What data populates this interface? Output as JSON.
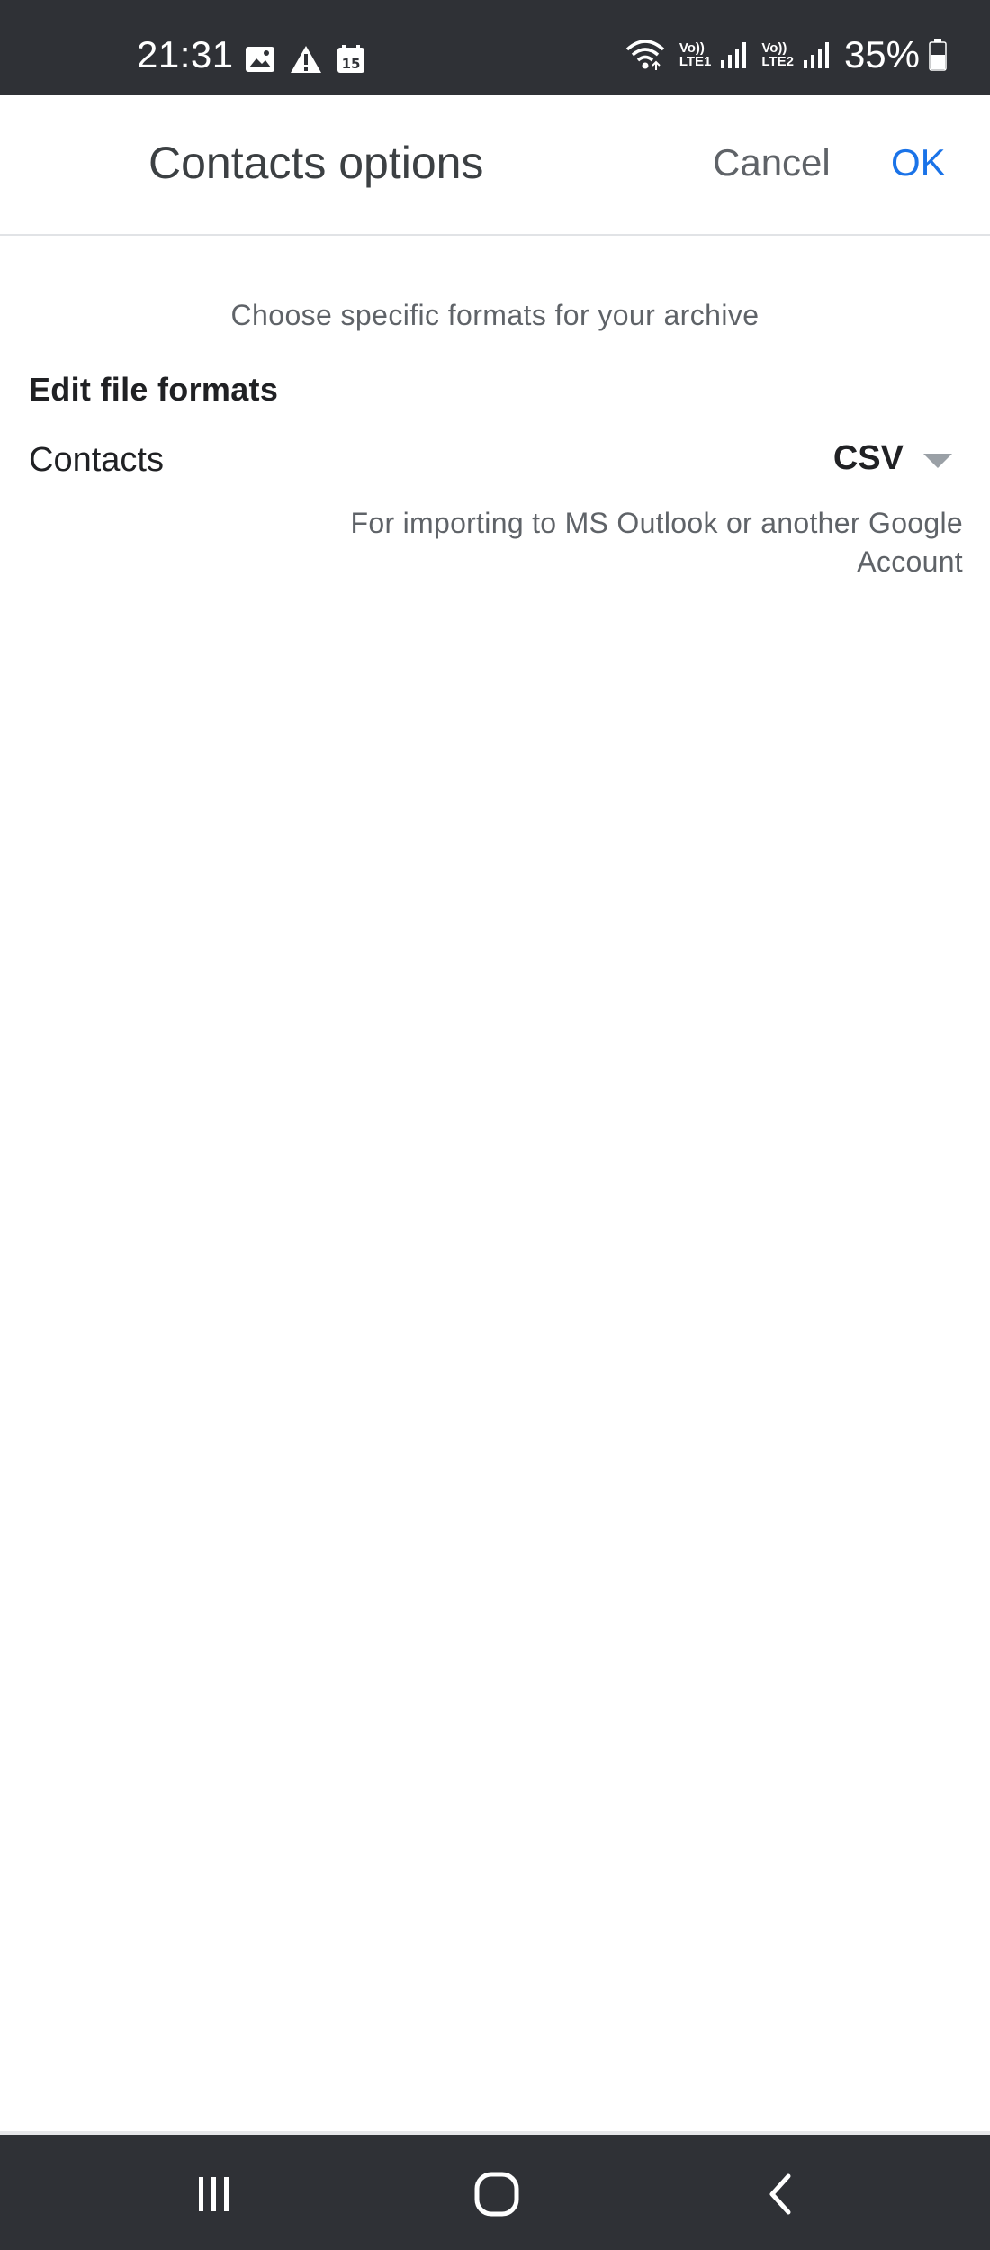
{
  "status_bar": {
    "time": "21:31",
    "battery": "35%",
    "sim1_label_top": "Vo))",
    "sim1_label_bottom": "LTE1",
    "sim2_label_top": "Vo))",
    "sim2_label_bottom": "LTE2",
    "calendar_day": "15",
    "icons_left": [
      "gallery-icon",
      "warning-icon",
      "calendar-icon"
    ],
    "icons_right": [
      "wifi-icon",
      "signal-icon",
      "signal-icon",
      "battery-icon"
    ]
  },
  "app_bar": {
    "title": "Contacts options",
    "cancel_label": "Cancel",
    "ok_label": "OK"
  },
  "content": {
    "subtitle": "Choose specific formats for your archive",
    "section_heading": "Edit file formats",
    "rows": [
      {
        "label": "Contacts",
        "selected_format": "CSV",
        "description": "For importing to MS Outlook or another Google Account"
      }
    ]
  },
  "nav_bar": {
    "buttons": [
      "recents-icon",
      "home-icon",
      "back-icon"
    ]
  },
  "colors": {
    "status_bar_bg": "#2f3136",
    "accent": "#1a73e8",
    "text_primary": "#202124",
    "text_secondary": "#5f6368"
  }
}
